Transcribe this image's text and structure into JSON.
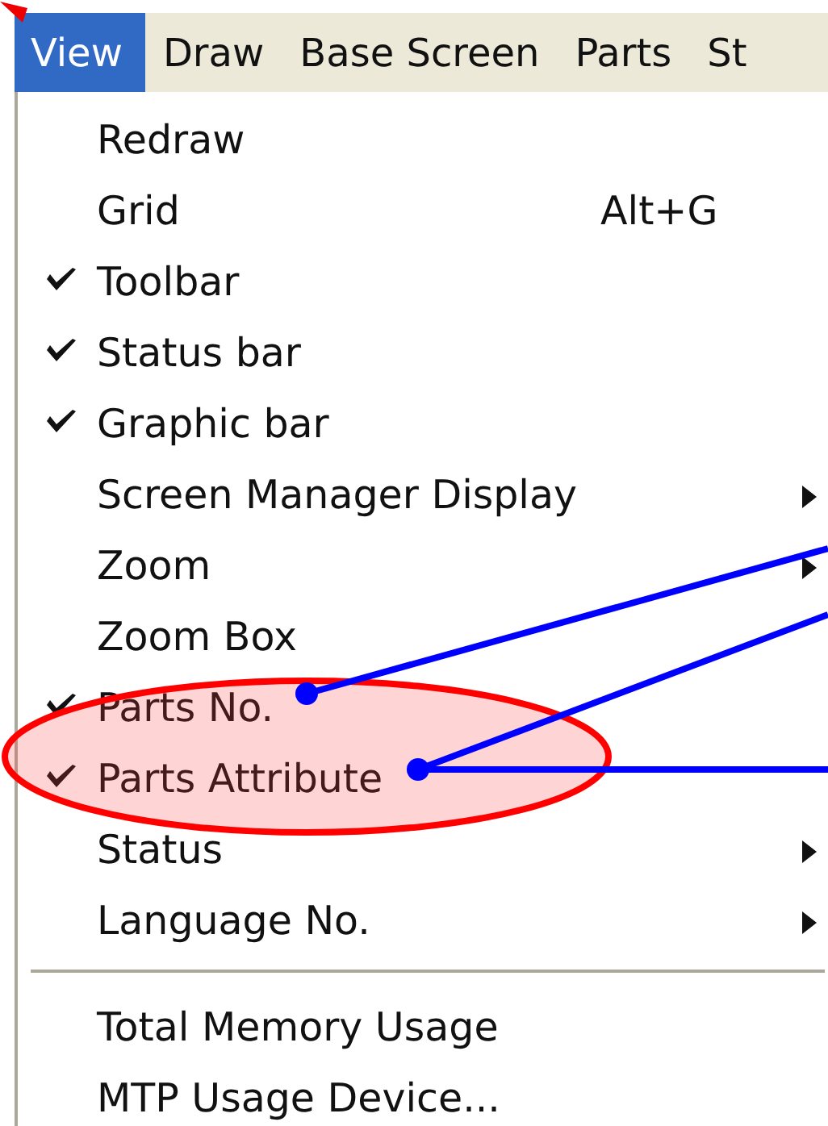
{
  "menu_bar": [
    {
      "label": "View",
      "selected": true
    },
    {
      "label": "Draw",
      "selected": false
    },
    {
      "label": "Base Screen",
      "selected": false
    },
    {
      "label": "Parts",
      "selected": false
    },
    {
      "label": "St",
      "selected": false
    }
  ],
  "view_menu": {
    "items": [
      {
        "kind": "item",
        "label": "Redraw",
        "checked": false,
        "submenu": false
      },
      {
        "kind": "item",
        "label": "Grid",
        "shortcut": "Alt+G",
        "checked": false,
        "submenu": false
      },
      {
        "kind": "item",
        "label": "Toolbar",
        "checked": true,
        "submenu": false
      },
      {
        "kind": "item",
        "label": "Status bar",
        "checked": true,
        "submenu": false
      },
      {
        "kind": "item",
        "label": "Graphic bar",
        "checked": true,
        "submenu": false
      },
      {
        "kind": "item",
        "label": "Screen Manager Display",
        "checked": false,
        "submenu": true
      },
      {
        "kind": "item",
        "label": "Zoom",
        "checked": false,
        "submenu": true
      },
      {
        "kind": "item",
        "label": "Zoom Box",
        "checked": false,
        "submenu": false
      },
      {
        "kind": "item",
        "label": "Parts No.",
        "checked": true,
        "submenu": false
      },
      {
        "kind": "item",
        "label": "Parts Attribute",
        "checked": true,
        "submenu": false
      },
      {
        "kind": "item",
        "label": "Status",
        "checked": false,
        "submenu": true
      },
      {
        "kind": "item",
        "label": "Language No.",
        "checked": false,
        "submenu": true
      },
      {
        "kind": "separator"
      },
      {
        "kind": "item",
        "label": "Total Memory Usage",
        "checked": false,
        "submenu": false
      },
      {
        "kind": "item",
        "label": "MTP Usage Device...",
        "checked": false,
        "submenu": false
      }
    ]
  }
}
